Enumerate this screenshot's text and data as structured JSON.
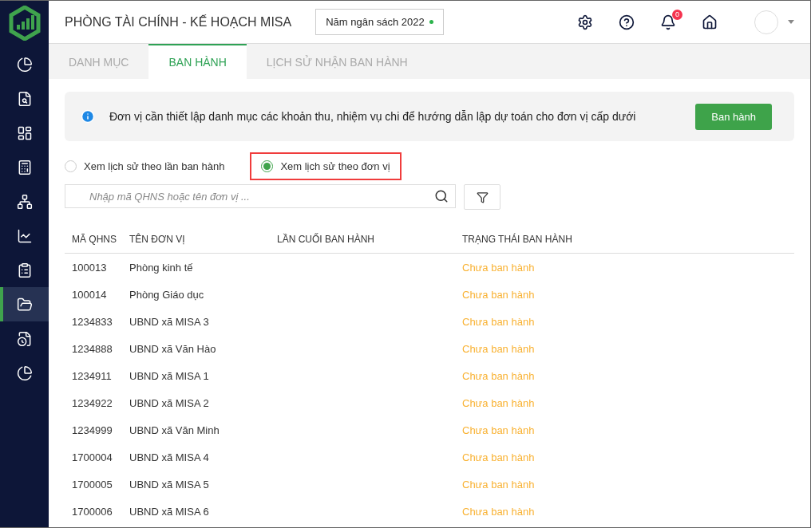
{
  "sidebar": {
    "items": [
      {
        "selected": false
      },
      {
        "selected": false
      },
      {
        "selected": false
      },
      {
        "selected": false
      },
      {
        "selected": false
      },
      {
        "selected": false
      },
      {
        "selected": false
      },
      {
        "selected": true
      },
      {
        "selected": false
      },
      {
        "selected": false
      }
    ]
  },
  "header": {
    "title": "PHÒNG TÀI CHÍNH - KẾ HOẠCH MISA",
    "budget_year": "Năm ngân sách 2022",
    "notification_count": "0"
  },
  "tabs": [
    {
      "label": "DANH MỤC",
      "selected": false
    },
    {
      "label": "BAN HÀNH",
      "selected": true
    },
    {
      "label": "LỊCH SỬ NHẬN BAN HÀNH",
      "selected": false
    }
  ],
  "banner": {
    "message": "Đơn vị cần thiết lập danh mục các khoản thu, nhiệm vụ chi để hướng dẫn lập dự toán cho đơn vị cấp dưới",
    "button": "Ban hành"
  },
  "view_options": [
    {
      "label": "Xem lịch sử theo lần ban hành",
      "selected": false,
      "highlighted": false
    },
    {
      "label": "Xem lịch sử theo đơn vị",
      "selected": true,
      "highlighted": true
    }
  ],
  "search": {
    "placeholder": "Nhập mã QHNS hoặc tên đơn vị ..."
  },
  "table": {
    "columns": [
      "MÃ QHNS",
      "TÊN ĐƠN VỊ",
      "LẦN CUỐI BAN HÀNH",
      "TRẠNG THÁI BAN HÀNH"
    ],
    "rows": [
      [
        "100013",
        "Phòng kinh tế",
        "Chưa ban hành"
      ],
      [
        "100014",
        "Phòng Giáo dục",
        "Chưa ban hành"
      ],
      [
        "1234833",
        "UBND xã MISA 3",
        "Chưa ban hành"
      ],
      [
        "1234888",
        "UBND xã Văn Hào",
        "Chưa ban hành"
      ],
      [
        "1234911",
        "UBND xã MISA 1",
        "Chưa ban hành"
      ],
      [
        "1234922",
        "UBND xã MISA 2",
        "Chưa ban hành"
      ],
      [
        "1234999",
        "UBND xã Văn Minh",
        "Chưa ban hành"
      ],
      [
        "1700004",
        "UBND xã MISA 4",
        "Chưa ban hành"
      ],
      [
        "1700005",
        "UBND xã MISA 5",
        "Chưa ban hành"
      ],
      [
        "1700006",
        "UBND xã MISA 6",
        "Chưa ban hành"
      ]
    ]
  }
}
